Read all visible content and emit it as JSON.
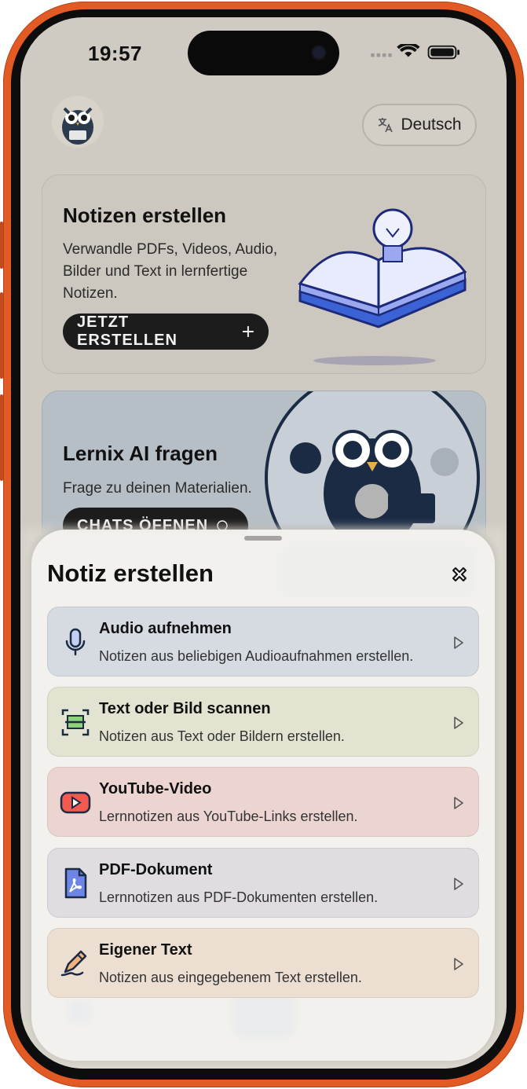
{
  "status": {
    "time": "19:57"
  },
  "header": {
    "language_label": "Deutsch"
  },
  "cards": {
    "create": {
      "title": "Notizen erstellen",
      "text": "Verwandle PDFs, Videos, Audio, Bilder und Text in lernfertige Notizen.",
      "button": "JETZT ERSTELLEN"
    },
    "ask": {
      "title": "Lernix AI fragen",
      "text": "Frage zu deinen Materialien.",
      "button": "CHATS ÖFFNEN"
    }
  },
  "sheet": {
    "title": "Notiz erstellen",
    "options": [
      {
        "title": "Audio aufnehmen",
        "subtitle": "Notizen aus beliebigen Audioaufnahmen erstellen.",
        "icon": "microphone-icon",
        "color": "#d5dbe1"
      },
      {
        "title": "Text oder Bild scannen",
        "subtitle": "Notizen aus Text oder Bildern erstellen.",
        "icon": "scan-icon",
        "color": "#e3e3d1"
      },
      {
        "title": "YouTube-Video",
        "subtitle": "Lernnotizen aus YouTube-Links erstellen.",
        "icon": "youtube-icon",
        "color": "#ecd5d0"
      },
      {
        "title": "PDF-Dokument",
        "subtitle": "Lernnotizen aus PDF-Dokumenten erstellen.",
        "icon": "pdf-icon",
        "color": "#e0dde2"
      },
      {
        "title": "Eigener Text",
        "subtitle": "Notizen aus eingegebenem Text erstellen.",
        "icon": "pen-edit-icon",
        "color": "#ecdfd1"
      }
    ]
  },
  "colors": {
    "frame": "#e25b25",
    "accent_blue": "#3b63d6",
    "dark_pill": "#1c1c1c"
  }
}
